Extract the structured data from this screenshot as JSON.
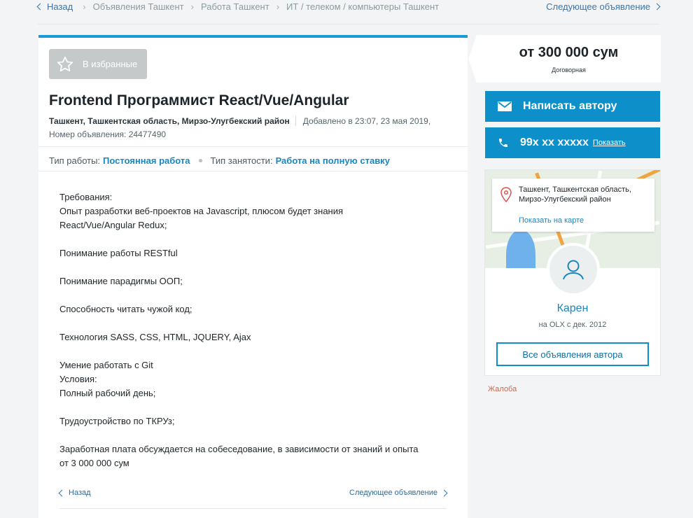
{
  "breadcrumb": {
    "back": "Назад",
    "items": [
      "Объявления Ташкент",
      "Работа Ташкент",
      "ИТ / телеком / компьютеры Ташкент"
    ],
    "next": "Следующее объявление"
  },
  "ad": {
    "favorite_label": "В избранные",
    "title": "Frontend Программист React/Vue/Angular",
    "location": "Ташкент, Ташкентская область, Мирзо-Улугбекский район",
    "added": "Добавлено в 23:07, 23 мая 2019,",
    "number": "Номер объявления: 24477490",
    "params": [
      {
        "label": "Тип работы:",
        "value": "Постоянная работа"
      },
      {
        "label": "Тип занятости:",
        "value": "Работа на полную ставку"
      }
    ],
    "description": [
      "Требования:",
      "Опыт разработки веб-проектов на Javascript, плюсом будет знания",
      "React/Vue/Angular  Redux;",
      "",
      "Понимание работы RESTful",
      "",
      "Понимание парадигмы ООП;",
      "",
      "Способность читать чужой код;",
      "",
      "Технология SASS, CSS, HTML, JQUERY, Ajax",
      "",
      "Умение работать с Git",
      "Условия:",
      "Полный рабочий день;",
      "",
      "Трудоустройство по ТКРУз;",
      "",
      "Заработная плата обсуждается на собеседование, в зависимости от знаний и опыта",
      "от 3 000 000 сум"
    ],
    "nav_back": "Назад",
    "nav_next": "Следующее объявление"
  },
  "sidebar": {
    "price": "от 300 000 сум",
    "price_note": "Договорная",
    "write_author": "Написать автору",
    "phone": "99x xx xxxxx",
    "phone_show": "Показать",
    "map_address": "Ташкент, Ташкентская область, Мирзо-Улугбекский район",
    "map_link": "Показать на карте",
    "user_name": "Карен",
    "user_since": "на OLX с дек. 2012",
    "all_ads": "Все объявления автора",
    "complaint": "Жалоба"
  },
  "colors": {
    "accent": "#0d8fca",
    "link": "#1b86bf",
    "complaint": "#c76a53"
  }
}
